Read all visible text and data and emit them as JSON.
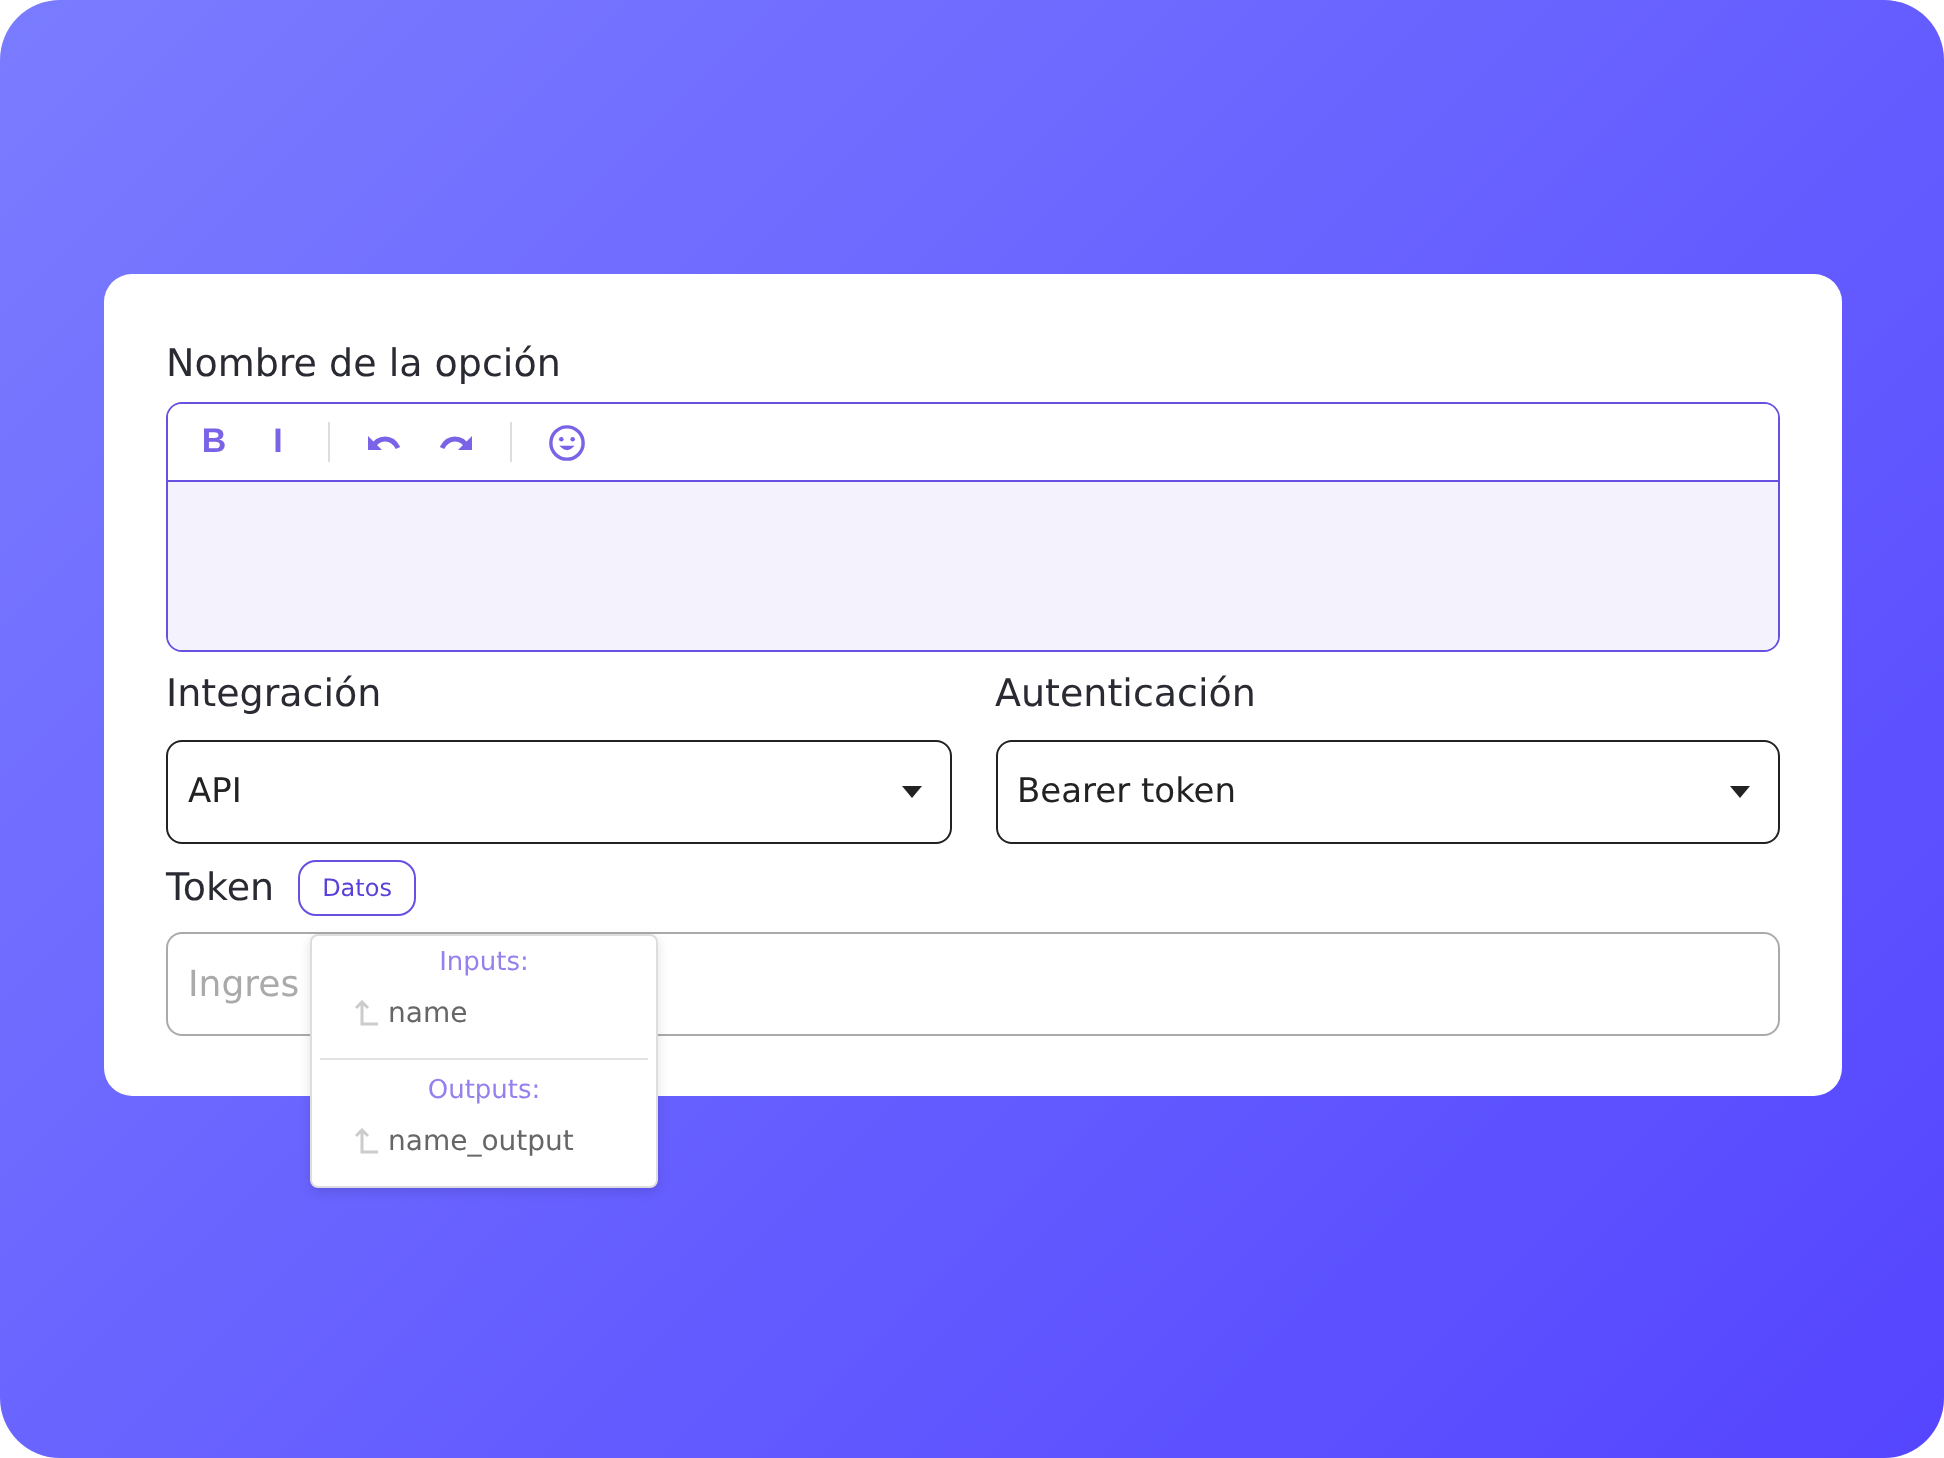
{
  "option_name": {
    "label": "Nombre de la opción",
    "toolbar": [
      {
        "kind": "text",
        "label": "B"
      },
      {
        "kind": "text",
        "label": "I"
      },
      {
        "kind": "divider"
      },
      {
        "kind": "undo"
      },
      {
        "kind": "redo"
      },
      {
        "kind": "divider"
      },
      {
        "kind": "emoji"
      }
    ]
  },
  "integration": {
    "label": "Integración",
    "value": "API"
  },
  "authentication": {
    "label": "Autenticación",
    "value": "Bearer token"
  },
  "token": {
    "label": "Token",
    "data_button": "Datos",
    "placeholder": "Ingres"
  },
  "data_menu": {
    "sections": [
      {
        "title": "Inputs:",
        "items": [
          "name"
        ]
      },
      {
        "title": "Outputs:",
        "items": [
          "name_output"
        ]
      }
    ]
  }
}
